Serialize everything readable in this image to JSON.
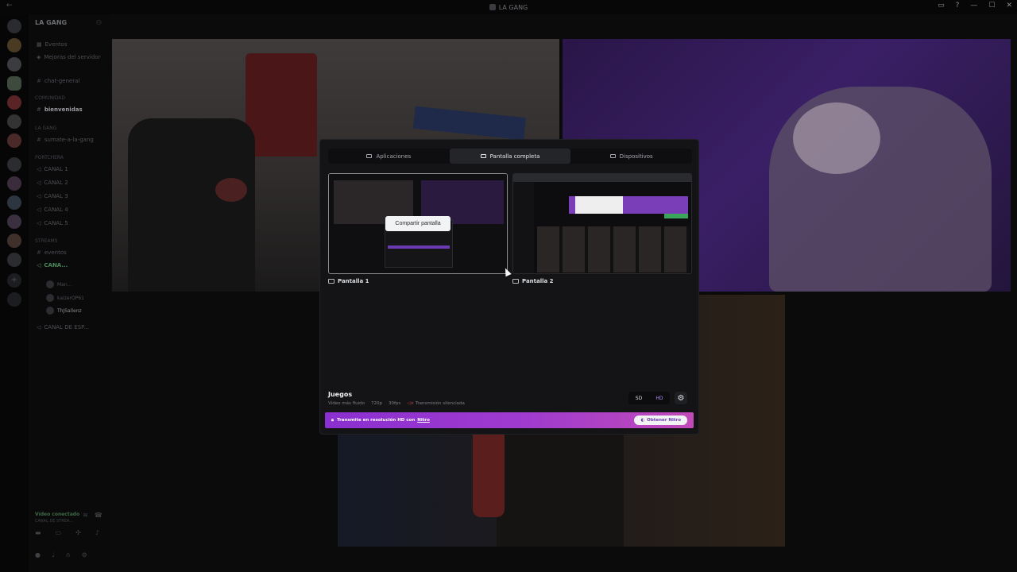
{
  "window": {
    "title": "LA GANG"
  },
  "sidebar": {
    "guild_name": "LA GANG",
    "items": [
      {
        "label": "Eventos"
      },
      {
        "label": "Mejoras del servidor"
      },
      {
        "label": "chat-general"
      }
    ],
    "categories": [
      {
        "label": "COMUNIDAD",
        "channels": [
          "bienvenidas"
        ]
      },
      {
        "label": "LA GANG",
        "channels": [
          "sumate-a-la-gang"
        ]
      },
      {
        "label": "PORTCHERA",
        "channels": [
          "CANAL 1",
          "CANAL 2",
          "CANAL 3",
          "CANAL 4",
          "CANAL 5"
        ]
      },
      {
        "label": "STREAMS",
        "channels": [
          "eventos",
          "CANA..."
        ]
      }
    ],
    "voice_users": [
      "Man...",
      "kaizerOP61",
      "ThJSallenz"
    ],
    "extra_channel": "CANAL DE ESP...",
    "voice_status": {
      "title": "Vídeo conectado",
      "subtitle": "CANAL DE STREA..."
    }
  },
  "dialog": {
    "tabs": [
      {
        "label": "Aplicaciones",
        "icon": "app-icon"
      },
      {
        "label": "Pantalla completa",
        "icon": "monitor-icon"
      },
      {
        "label": "Dispositivos",
        "icon": "camera-icon"
      }
    ],
    "screens": [
      {
        "label": "Pantalla 1",
        "icon": "monitor-icon"
      },
      {
        "label": "Pantalla 2",
        "icon": "monitor-icon"
      }
    ],
    "share_button": "Compartir pantalla",
    "quality": {
      "title": "Juegos",
      "subtitle": "Vídeo más fluido",
      "resolution": "720p",
      "fps": "30fps",
      "audio": "Transmisión silenciada"
    },
    "res_toggle": {
      "sd": "SD",
      "hd": "HD"
    },
    "nitro": {
      "text": "Transmite en resolución HD con",
      "link": "Nitro",
      "button": "Obtener Nitro"
    }
  },
  "colors": {
    "accent": "#9b3bd0",
    "hd": "#b48ef0",
    "mute": "#c04848"
  }
}
